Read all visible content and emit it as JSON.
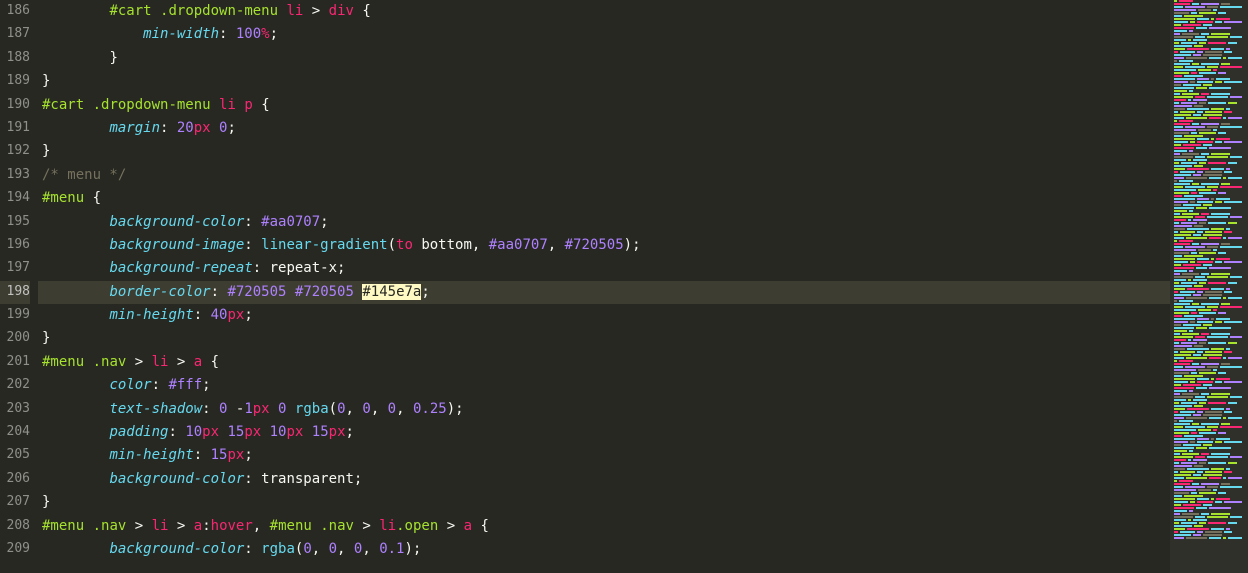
{
  "activeLine": 198,
  "lines": [
    {
      "n": 186,
      "indent": 2,
      "tokens": [
        {
          "t": "id",
          "v": "#cart"
        },
        {
          "t": "def",
          "v": " "
        },
        {
          "t": "cls",
          "v": ".dropdown-menu"
        },
        {
          "t": "def",
          "v": " "
        },
        {
          "t": "tag",
          "v": "li"
        },
        {
          "t": "def",
          "v": " > "
        },
        {
          "t": "tag",
          "v": "div"
        },
        {
          "t": "def",
          "v": " {"
        }
      ]
    },
    {
      "n": 187,
      "indent": 3,
      "tokens": [
        {
          "t": "prop",
          "v": "min-width"
        },
        {
          "t": "def",
          "v": ": "
        },
        {
          "t": "num",
          "v": "100"
        },
        {
          "t": "unit",
          "v": "%"
        },
        {
          "t": "def",
          "v": ";"
        }
      ]
    },
    {
      "n": 188,
      "indent": 2,
      "tokens": [
        {
          "t": "def",
          "v": "}"
        }
      ]
    },
    {
      "n": 189,
      "indent": 0,
      "tokens": [
        {
          "t": "def",
          "v": "}"
        }
      ]
    },
    {
      "n": 190,
      "indent": 0,
      "tokens": [
        {
          "t": "id",
          "v": "#cart"
        },
        {
          "t": "def",
          "v": " "
        },
        {
          "t": "cls",
          "v": ".dropdown-menu"
        },
        {
          "t": "def",
          "v": " "
        },
        {
          "t": "tag",
          "v": "li"
        },
        {
          "t": "def",
          "v": " "
        },
        {
          "t": "tag",
          "v": "p"
        },
        {
          "t": "def",
          "v": " {"
        }
      ]
    },
    {
      "n": 191,
      "indent": 2,
      "tokens": [
        {
          "t": "prop",
          "v": "margin"
        },
        {
          "t": "def",
          "v": ": "
        },
        {
          "t": "num",
          "v": "20"
        },
        {
          "t": "unit",
          "v": "px"
        },
        {
          "t": "def",
          "v": " "
        },
        {
          "t": "num",
          "v": "0"
        },
        {
          "t": "def",
          "v": ";"
        }
      ]
    },
    {
      "n": 192,
      "indent": 0,
      "tokens": [
        {
          "t": "def",
          "v": "}"
        }
      ]
    },
    {
      "n": 193,
      "indent": 0,
      "tokens": [
        {
          "t": "cmt",
          "v": "/* menu */"
        }
      ]
    },
    {
      "n": 194,
      "indent": 0,
      "tokens": [
        {
          "t": "id",
          "v": "#menu"
        },
        {
          "t": "def",
          "v": " {"
        }
      ]
    },
    {
      "n": 195,
      "indent": 2,
      "tokens": [
        {
          "t": "prop",
          "v": "background-color"
        },
        {
          "t": "def",
          "v": ": "
        },
        {
          "t": "hex",
          "v": "#aa0707"
        },
        {
          "t": "def",
          "v": ";"
        }
      ]
    },
    {
      "n": 196,
      "indent": 2,
      "tokens": [
        {
          "t": "prop",
          "v": "background-image"
        },
        {
          "t": "def",
          "v": ": "
        },
        {
          "t": "fn",
          "v": "linear-gradient"
        },
        {
          "t": "def",
          "v": "("
        },
        {
          "t": "kw",
          "v": "to"
        },
        {
          "t": "def",
          "v": " bottom, "
        },
        {
          "t": "hex",
          "v": "#aa0707"
        },
        {
          "t": "def",
          "v": ", "
        },
        {
          "t": "hex",
          "v": "#720505"
        },
        {
          "t": "def",
          "v": ");"
        }
      ]
    },
    {
      "n": 197,
      "indent": 2,
      "tokens": [
        {
          "t": "prop",
          "v": "background-repeat"
        },
        {
          "t": "def",
          "v": ": repeat-x;"
        }
      ]
    },
    {
      "n": 198,
      "indent": 2,
      "tokens": [
        {
          "t": "prop",
          "v": "border-color"
        },
        {
          "t": "def",
          "v": ": "
        },
        {
          "t": "hex",
          "v": "#720505"
        },
        {
          "t": "def",
          "v": " "
        },
        {
          "t": "hex",
          "v": "#720505"
        },
        {
          "t": "def",
          "v": " "
        },
        {
          "t": "hl",
          "v": "#145e7a"
        },
        {
          "t": "def",
          "v": ";"
        }
      ]
    },
    {
      "n": 199,
      "indent": 2,
      "tokens": [
        {
          "t": "prop",
          "v": "min-height"
        },
        {
          "t": "def",
          "v": ": "
        },
        {
          "t": "num",
          "v": "40"
        },
        {
          "t": "unit",
          "v": "px"
        },
        {
          "t": "def",
          "v": ";"
        }
      ]
    },
    {
      "n": 200,
      "indent": 0,
      "tokens": [
        {
          "t": "def",
          "v": "}"
        }
      ]
    },
    {
      "n": 201,
      "indent": 0,
      "tokens": [
        {
          "t": "id",
          "v": "#menu"
        },
        {
          "t": "def",
          "v": " "
        },
        {
          "t": "cls",
          "v": ".nav"
        },
        {
          "t": "def",
          "v": " > "
        },
        {
          "t": "tag",
          "v": "li"
        },
        {
          "t": "def",
          "v": " > "
        },
        {
          "t": "tag",
          "v": "a"
        },
        {
          "t": "def",
          "v": " {"
        }
      ]
    },
    {
      "n": 202,
      "indent": 2,
      "tokens": [
        {
          "t": "prop",
          "v": "color"
        },
        {
          "t": "def",
          "v": ": "
        },
        {
          "t": "hex",
          "v": "#fff"
        },
        {
          "t": "def",
          "v": ";"
        }
      ]
    },
    {
      "n": 203,
      "indent": 2,
      "tokens": [
        {
          "t": "prop",
          "v": "text-shadow"
        },
        {
          "t": "def",
          "v": ": "
        },
        {
          "t": "num",
          "v": "0"
        },
        {
          "t": "def",
          "v": " -"
        },
        {
          "t": "num",
          "v": "1"
        },
        {
          "t": "unit",
          "v": "px"
        },
        {
          "t": "def",
          "v": " "
        },
        {
          "t": "num",
          "v": "0"
        },
        {
          "t": "def",
          "v": " "
        },
        {
          "t": "fn",
          "v": "rgba"
        },
        {
          "t": "def",
          "v": "("
        },
        {
          "t": "num",
          "v": "0"
        },
        {
          "t": "def",
          "v": ", "
        },
        {
          "t": "num",
          "v": "0"
        },
        {
          "t": "def",
          "v": ", "
        },
        {
          "t": "num",
          "v": "0"
        },
        {
          "t": "def",
          "v": ", "
        },
        {
          "t": "num",
          "v": "0.25"
        },
        {
          "t": "def",
          "v": ");"
        }
      ]
    },
    {
      "n": 204,
      "indent": 2,
      "tokens": [
        {
          "t": "prop",
          "v": "padding"
        },
        {
          "t": "def",
          "v": ": "
        },
        {
          "t": "num",
          "v": "10"
        },
        {
          "t": "unit",
          "v": "px"
        },
        {
          "t": "def",
          "v": " "
        },
        {
          "t": "num",
          "v": "15"
        },
        {
          "t": "unit",
          "v": "px"
        },
        {
          "t": "def",
          "v": " "
        },
        {
          "t": "num",
          "v": "10"
        },
        {
          "t": "unit",
          "v": "px"
        },
        {
          "t": "def",
          "v": " "
        },
        {
          "t": "num",
          "v": "15"
        },
        {
          "t": "unit",
          "v": "px"
        },
        {
          "t": "def",
          "v": ";"
        }
      ]
    },
    {
      "n": 205,
      "indent": 2,
      "tokens": [
        {
          "t": "prop",
          "v": "min-height"
        },
        {
          "t": "def",
          "v": ": "
        },
        {
          "t": "num",
          "v": "15"
        },
        {
          "t": "unit",
          "v": "px"
        },
        {
          "t": "def",
          "v": ";"
        }
      ]
    },
    {
      "n": 206,
      "indent": 2,
      "tokens": [
        {
          "t": "prop",
          "v": "background-color"
        },
        {
          "t": "def",
          "v": ": transparent;"
        }
      ]
    },
    {
      "n": 207,
      "indent": 0,
      "tokens": [
        {
          "t": "def",
          "v": "}"
        }
      ]
    },
    {
      "n": 208,
      "indent": 0,
      "tokens": [
        {
          "t": "id",
          "v": "#menu"
        },
        {
          "t": "def",
          "v": " "
        },
        {
          "t": "cls",
          "v": ".nav"
        },
        {
          "t": "def",
          "v": " > "
        },
        {
          "t": "tag",
          "v": "li"
        },
        {
          "t": "def",
          "v": " > "
        },
        {
          "t": "tag",
          "v": "a"
        },
        {
          "t": "def",
          "v": ":"
        },
        {
          "t": "kw",
          "v": "hover"
        },
        {
          "t": "def",
          "v": ", "
        },
        {
          "t": "id",
          "v": "#menu"
        },
        {
          "t": "def",
          "v": " "
        },
        {
          "t": "cls",
          "v": ".nav"
        },
        {
          "t": "def",
          "v": " > "
        },
        {
          "t": "tag",
          "v": "li"
        },
        {
          "t": "cls",
          "v": ".open"
        },
        {
          "t": "def",
          "v": " > "
        },
        {
          "t": "tag",
          "v": "a"
        },
        {
          "t": "def",
          "v": " {"
        }
      ]
    },
    {
      "n": 209,
      "indent": 2,
      "tokens": [
        {
          "t": "prop",
          "v": "background-color"
        },
        {
          "t": "def",
          "v": ": "
        },
        {
          "t": "fn",
          "v": "rgba"
        },
        {
          "t": "def",
          "v": "("
        },
        {
          "t": "num",
          "v": "0"
        },
        {
          "t": "def",
          "v": ", "
        },
        {
          "t": "num",
          "v": "0"
        },
        {
          "t": "def",
          "v": ", "
        },
        {
          "t": "num",
          "v": "0"
        },
        {
          "t": "def",
          "v": ", "
        },
        {
          "t": "num",
          "v": "0.1"
        },
        {
          "t": "def",
          "v": ");"
        }
      ]
    }
  ]
}
